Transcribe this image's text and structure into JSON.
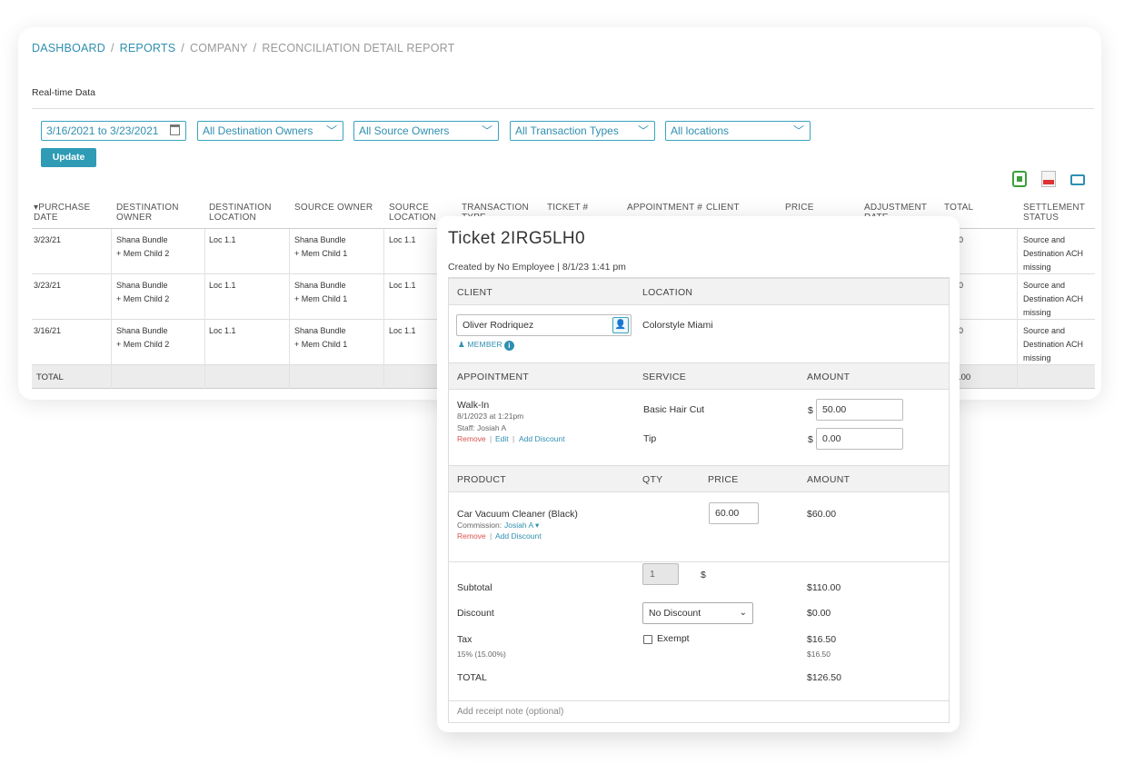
{
  "breadcrumb": {
    "dashboard": "DASHBOARD",
    "reports": "REPORTS",
    "company": "COMPANY",
    "current": "RECONCILIATION DETAIL REPORT",
    "separator": "/"
  },
  "realtime_label": "Real-time Data",
  "filters": {
    "date_range": "3/16/2021 to 3/23/2021",
    "destination_owners": "All Destination Owners",
    "source_owners": "All Source Owners",
    "transaction_types": "All Transaction Types",
    "locations": "All locations",
    "chevron": "﹀",
    "update_label": "Update"
  },
  "export_icons": [
    "excel-icon",
    "pdf-icon",
    "print-icon"
  ],
  "report": {
    "columns": [
      "▾PURCHASE\nDATE",
      "DESTINATION\nOWNER",
      "DESTINATION\nLOCATION",
      "SOURCE OWNER",
      "SOURCE\nLOCATION",
      "TRANSACTION\nTYPE",
      "TICKET #",
      "APPOINTMENT #",
      "CLIENT",
      "PRICE",
      "ADJUSTMENT\nRATE",
      "TOTAL",
      "SETTLEMENT\nSTATUS"
    ],
    "rows": [
      {
        "date": "3/23/21",
        "dest_owner": "Shana Bundle\n+ Mem Child 2",
        "dest_loc": "Loc 1.1",
        "src_owner": "Shana Bundle\n+ Mem Child 1",
        "src_loc": "Loc 1.1",
        "total": "0",
        "status": "Source and\nDestination ACH\nmissing"
      },
      {
        "date": "3/23/21",
        "dest_owner": "Shana Bundle\n+ Mem Child 2",
        "dest_loc": "Loc 1.1",
        "src_owner": "Shana Bundle\n+ Mem Child 1",
        "src_loc": "Loc 1.1",
        "total": "0",
        "status": "Source and\nDestination ACH\nmissing"
      },
      {
        "date": "3/16/21",
        "dest_owner": "Shana Bundle\n+ Mem Child 2",
        "dest_loc": "Loc 1.1",
        "src_owner": "Shana Bundle\n+ Mem Child 1",
        "src_loc": "Loc 1.1",
        "total": "0",
        "status": "Source and\nDestination ACH\nmissing"
      }
    ],
    "total_label": "TOTAL",
    "total_value": ".00"
  },
  "ticket": {
    "title": "Ticket 2IRG5LH0",
    "created": "Created by No Employee  |  8/1/23 1:41 pm",
    "client_header": "CLIENT",
    "location_header": "LOCATION",
    "client_name": "Oliver Rodriquez",
    "member_label": "MEMBER",
    "location_name": "Colorstyle Miami",
    "appointment_header": "APPOINTMENT",
    "service_header": "SERVICE",
    "amount_header": "AMOUNT",
    "appointment": {
      "type": "Walk-In",
      "datetime": "8/1/2023 at 1:21pm",
      "staff": "Staff: Josiah A",
      "remove": "Remove",
      "edit": "Edit",
      "add_discount": "Add Discount",
      "sep": "|"
    },
    "services": [
      {
        "name": "Basic Hair Cut",
        "currency": "$",
        "amount": "50.00"
      },
      {
        "name": "Tip",
        "currency": "$",
        "amount": "0.00"
      }
    ],
    "product_header": "PRODUCT",
    "qty_header": "QTY",
    "price_header": "PRICE",
    "product_amount_header": "AMOUNT",
    "product": {
      "name": "Car Vacuum Cleaner (Black)",
      "commission_label": "Commission:",
      "commission_staff": "Josiah A ▾",
      "remove": "Remove",
      "add_discount": "Add Discount",
      "qty": "1",
      "currency": "$",
      "price": "60.00",
      "amount": "$60.00"
    },
    "subtotal_label": "Subtotal",
    "subtotal_value": "$110.00",
    "discount_label": "Discount",
    "discount_select": "No Discount",
    "discount_value": "$0.00",
    "tax_label": "Tax",
    "tax_rate": "15% (15.00%)",
    "exempt_label": "Exempt",
    "tax_value": "$16.50",
    "tax_value_small": "$16.50",
    "total_label": "TOTAL",
    "total_value": "$126.50",
    "note_placeholder": "Add receipt note (optional)"
  }
}
